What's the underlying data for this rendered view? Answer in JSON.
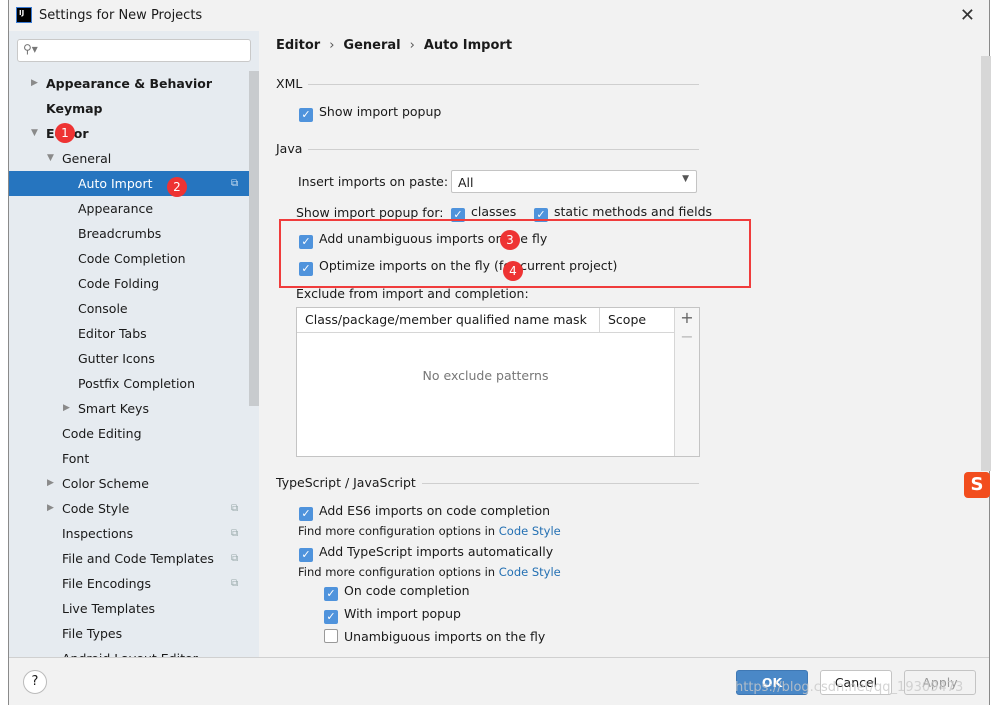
{
  "window": {
    "title": "Settings for New Projects",
    "logo": "IJ"
  },
  "search": {
    "placeholder": ""
  },
  "sidebar": {
    "items": [
      {
        "label": "Appearance & Behavior",
        "level": 0,
        "arrow": "collapsed",
        "bold": true
      },
      {
        "label": "Keymap",
        "level": 0,
        "bold": true
      },
      {
        "label": "Editor",
        "level": 0,
        "arrow": "expanded",
        "bold": true
      },
      {
        "label": "General",
        "level": 1,
        "arrow": "expanded"
      },
      {
        "label": "Auto Import",
        "level": 2,
        "selected": true,
        "copy": true
      },
      {
        "label": "Appearance",
        "level": 2
      },
      {
        "label": "Breadcrumbs",
        "level": 2
      },
      {
        "label": "Code Completion",
        "level": 2
      },
      {
        "label": "Code Folding",
        "level": 2
      },
      {
        "label": "Console",
        "level": 2
      },
      {
        "label": "Editor Tabs",
        "level": 2
      },
      {
        "label": "Gutter Icons",
        "level": 2
      },
      {
        "label": "Postfix Completion",
        "level": 2
      },
      {
        "label": "Smart Keys",
        "level": 2,
        "arrow": "collapsed"
      },
      {
        "label": "Code Editing",
        "level": 1
      },
      {
        "label": "Font",
        "level": 1
      },
      {
        "label": "Color Scheme",
        "level": 1,
        "arrow": "collapsed"
      },
      {
        "label": "Code Style",
        "level": 1,
        "arrow": "collapsed",
        "copy": true
      },
      {
        "label": "Inspections",
        "level": 1,
        "copy": true
      },
      {
        "label": "File and Code Templates",
        "level": 1,
        "copy": true
      },
      {
        "label": "File Encodings",
        "level": 1,
        "copy": true
      },
      {
        "label": "Live Templates",
        "level": 1
      },
      {
        "label": "File Types",
        "level": 1
      },
      {
        "label": "Android Layout Editor",
        "level": 1
      }
    ]
  },
  "breadcrumb": [
    "Editor",
    "General",
    "Auto Import"
  ],
  "xml": {
    "section": "XML",
    "show_popup": "Show import popup"
  },
  "java": {
    "section": "Java",
    "insert_label": "Insert imports on paste:",
    "insert_value": "All",
    "popup_for": "Show import popup for:",
    "classes": "classes",
    "static": "static methods and fields",
    "unambiguous": "Add unambiguous imports on the fly",
    "optimize": "Optimize imports on the fly (for current project)",
    "exclude_label": "Exclude from import and completion:",
    "col1": "Class/package/member qualified name mask",
    "col2": "Scope",
    "empty": "No exclude patterns",
    "add": "+",
    "remove": "−"
  },
  "ts": {
    "section": "TypeScript / JavaScript",
    "es6": "Add ES6 imports on code completion",
    "more": "Find more configuration options in ",
    "link": "Code Style",
    "tsauto": "Add TypeScript imports automatically",
    "on_completion": "On code completion",
    "with_popup": "With import popup",
    "unamb": "Unambiguous imports on the fly"
  },
  "annotations": [
    "1",
    "2",
    "3",
    "4"
  ],
  "footer": {
    "help": "?",
    "ok": "OK",
    "cancel": "Cancel",
    "apply": "Apply"
  },
  "watermark": "https://blog.csdn.net/qq_19309473",
  "colors": {
    "accent": "#2675bf",
    "checkbox": "#4f93dc",
    "highlight": "#f03c3c"
  }
}
